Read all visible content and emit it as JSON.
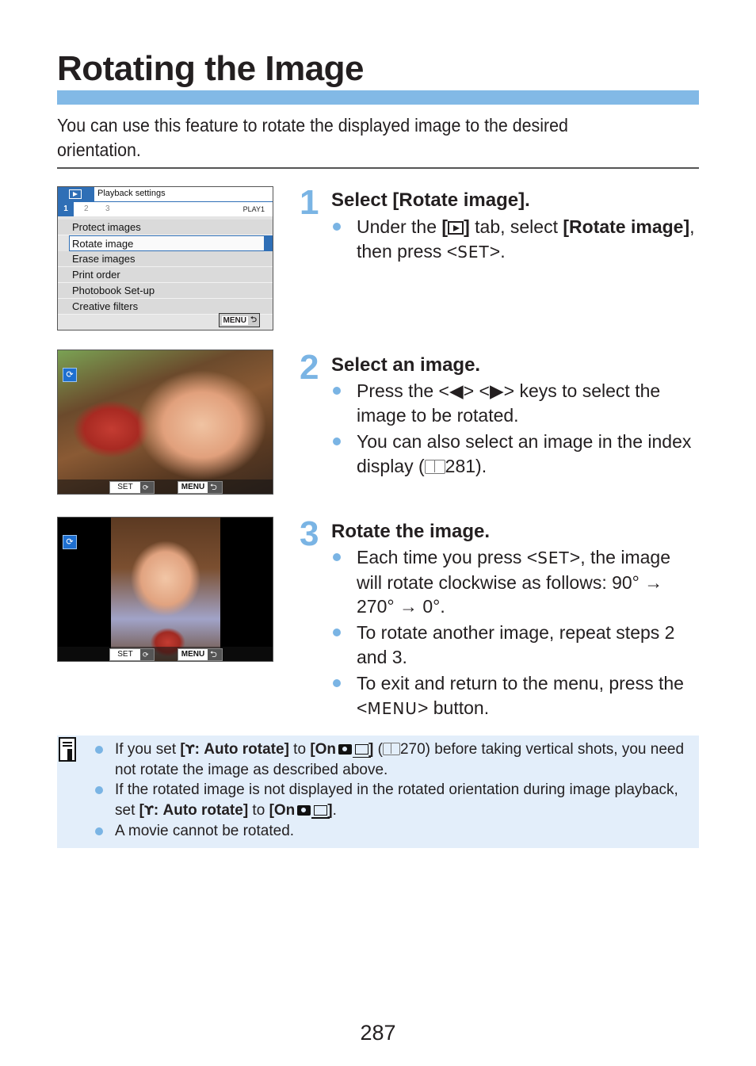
{
  "page": {
    "title": "Rotating the Image",
    "intro": "You can use this feature to rotate the displayed image to the desired orientation.",
    "page_number": "287",
    "accent_color": "#82b9e6"
  },
  "menu_screen": {
    "tab_icon": "playback-icon",
    "header": "Playback settings",
    "subtabs": [
      "1",
      "2",
      "3"
    ],
    "tab_code": "PLAY1",
    "items": [
      "Protect images",
      "Rotate image",
      "Erase images",
      "Print order",
      "Photobook Set-up",
      "Creative filters"
    ],
    "selected_item": "Rotate image",
    "footer_button": "MENU",
    "footer_icon": "return-icon"
  },
  "photo_screens": [
    {
      "description": "Image displayed rotated (landscape orientation of a vertical shot)",
      "set_label": "SET",
      "menu_label": "MENU"
    },
    {
      "description": "Image displayed in vertical orientation after rotation",
      "set_label": "SET",
      "menu_label": "MENU"
    }
  ],
  "steps": [
    {
      "number": "1",
      "title": "Select [Rotate image].",
      "bullets": [
        {
          "p1": "Under the ",
          "b1": "[",
          "b2": "]",
          "p2": " tab, select ",
          "b3": "[Rotate image]",
          "p3": ", then press <",
          "sym": "SET",
          "p4": ">."
        }
      ]
    },
    {
      "number": "2",
      "title": "Select an image.",
      "bullets": [
        {
          "p1": "Press the <",
          "sym1": "◀",
          "p2": "> <",
          "sym2": "▶",
          "p3": "> keys to select the image to be rotated."
        },
        {
          "p1": "You can also select an image in the index display (",
          "ref": "281",
          "p2": ")."
        }
      ]
    },
    {
      "number": "3",
      "title": "Rotate the image.",
      "bullets": [
        {
          "p1": "Each time you press <",
          "sym": "SET",
          "p2": ">, the image will rotate clockwise as follows: 90° → 270° → 0°."
        },
        {
          "p1": "To rotate another image, repeat steps 2 and 3."
        },
        {
          "p1": "To exit and return to the menu, press the <",
          "sym": "MENU",
          "p2": "> button."
        }
      ]
    }
  ],
  "note": {
    "icon": "note-pencil-icon",
    "items": [
      {
        "p1": "If you set ",
        "b1": "[",
        "b2": ": Auto rotate]",
        "p2": " to ",
        "b3": "[On",
        "b4": "]",
        "p3": " (",
        "ref": "270",
        "p4": ") before taking vertical shots, you need not rotate the image as described above."
      },
      {
        "p1": "If the rotated image is not displayed in the rotated orientation during image playback, set ",
        "b1": "[",
        "b2": ": Auto rotate]",
        "p2": " to ",
        "b3": "[On",
        "b4": "]",
        "p3": "."
      },
      {
        "p1": "A movie cannot be rotated."
      }
    ]
  }
}
